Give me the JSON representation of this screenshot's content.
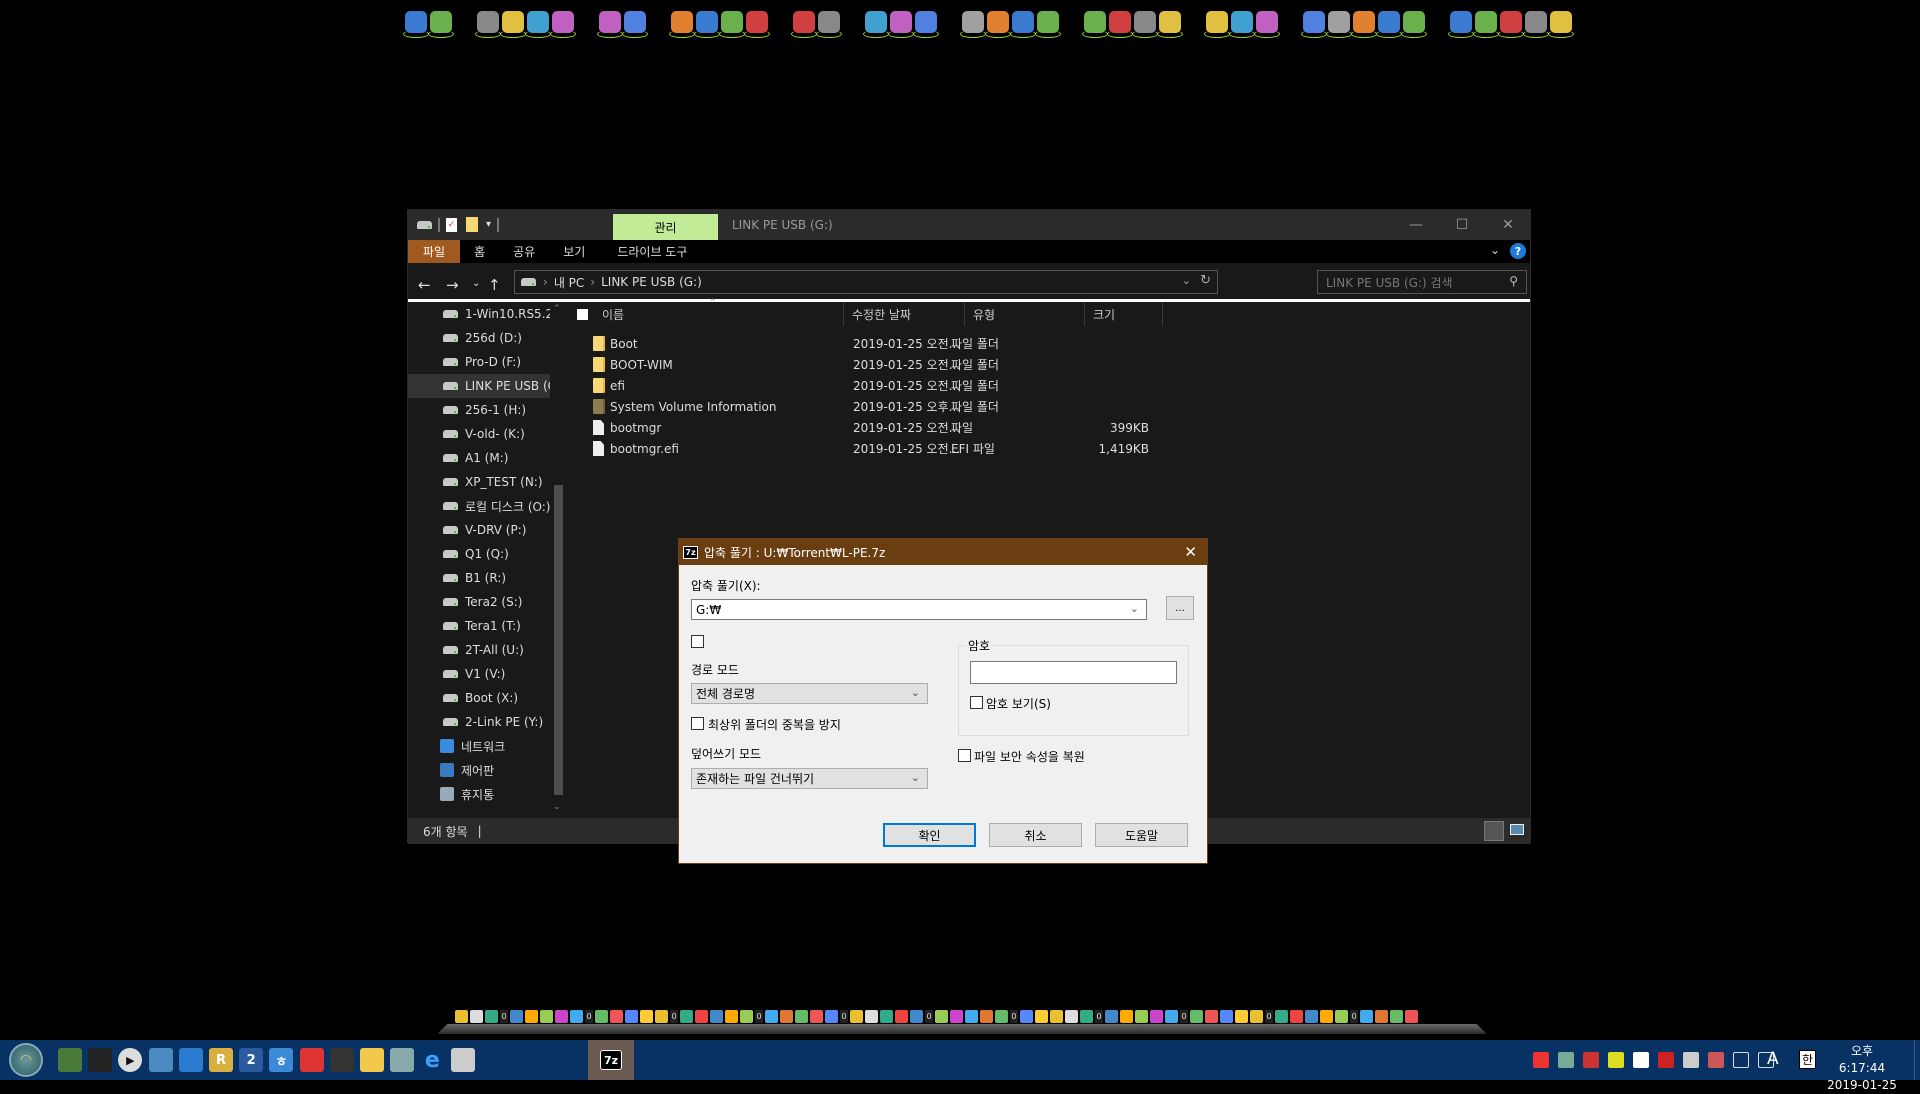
{
  "top_launcher": {
    "groups": [
      [
        "network-setup-icon",
        "network-disable-icon"
      ],
      [
        "laptop-icon",
        "monitor-icon",
        "tablet-icon",
        "red-tool-icon"
      ],
      [
        "puzzle-icon",
        "red-puzzle-icon"
      ],
      [
        "eraser-icon",
        "file-page-icon",
        "flower-icon",
        "windows-icon"
      ],
      [
        "pie-chart-icon",
        "paint-icon"
      ],
      [
        "pc-tower-icon",
        "text-a-icon",
        "fc-icon"
      ],
      [
        "nt-key-icon",
        "tools-icon",
        "recycle-icon",
        "cloud-icon"
      ],
      [
        "lightning-icon",
        "7zip-icon",
        "disc-icon",
        "usb-icon"
      ],
      [
        "cpu-64-icon",
        "chip-icon",
        "flash-icon"
      ],
      [
        "hdd-icon",
        "scanner-icon",
        "disk-wrench-icon",
        "blocks-icon",
        "unlock-icon"
      ],
      [
        "search-orange-icon",
        "search-blue-icon",
        "floppy-icon",
        "folder-dark-icon",
        "power-icon"
      ]
    ]
  },
  "explorer": {
    "qat_icons": [
      "drive-icon",
      "properties-icon",
      "new-folder-icon",
      "customize-qat-icon"
    ],
    "contextual_tab": "관리",
    "title": "LINK PE USB (G:)",
    "window_buttons": {
      "minimize": "—",
      "maximize": "☐",
      "close": "✕"
    },
    "ribbon_tabs": [
      "파일",
      "홈",
      "공유",
      "보기",
      "드라이브 도구"
    ],
    "address": {
      "breadcrumb": [
        "내 PC",
        "LINK PE USB (G:)"
      ],
      "search_placeholder": "LINK PE USB (G:) 검색"
    },
    "nav_pane": {
      "drives": [
        "1-Win10.RS5.2",
        "256d (D:)",
        "Pro-D (F:)",
        "LINK PE USB (G:)",
        "256-1 (H:)",
        "V-old- (K:)",
        "A1 (M:)",
        "XP_TEST (N:)",
        "로컬 디스크 (O:)",
        "V-DRV (P:)",
        "Q1 (Q:)",
        "B1 (R:)",
        "Tera2 (S:)",
        "Tera1 (T:)",
        "2T-All (U:)",
        "V1 (V:)",
        "Boot (X:)",
        "2-Link PE (Y:)"
      ],
      "selected_index": 3,
      "locations": [
        {
          "label": "네트워크",
          "icon": "network-icon"
        },
        {
          "label": "제어판",
          "icon": "control-panel-icon"
        },
        {
          "label": "휴지통",
          "icon": "recycle-bin-icon"
        }
      ]
    },
    "columns": [
      "이름",
      "수정한 날짜",
      "유형",
      "크기"
    ],
    "files": [
      {
        "name": "Boot",
        "date": "2019-01-25 오전...",
        "type": "파일 폴더",
        "size": "",
        "kind": "folder"
      },
      {
        "name": "BOOT-WIM",
        "date": "2019-01-25 오전...",
        "type": "파일 폴더",
        "size": "",
        "kind": "folder"
      },
      {
        "name": "efi",
        "date": "2019-01-25 오전...",
        "type": "파일 폴더",
        "size": "",
        "kind": "folder"
      },
      {
        "name": "System Volume Information",
        "date": "2019-01-25 오후...",
        "type": "파일 폴더",
        "size": "",
        "kind": "sysfolder"
      },
      {
        "name": "bootmgr",
        "date": "2019-01-25 오전...",
        "type": "파일",
        "size": "399KB",
        "kind": "file"
      },
      {
        "name": "bootmgr.efi",
        "date": "2019-01-25 오전...",
        "type": "EFI 파일",
        "size": "1,419KB",
        "kind": "file"
      }
    ],
    "status": "6개 항목",
    "view_buttons": [
      "details-view",
      "large-icons-view"
    ]
  },
  "extract_dialog": {
    "title": "압축 풀기 : U:₩Torrent₩L-PE.7z",
    "extract_to_label": "압축 풀기(X):",
    "extract_to_value": "G:₩",
    "browse_label": "...",
    "path_mode_label": "경로 모드",
    "path_mode_value": "전체 경로명",
    "eliminate_duplicate_label": "최상위 폴더의 중복을 방지",
    "overwrite_mode_label": "덮어쓰기 모드",
    "overwrite_mode_value": "존재하는 파일 건너뛰기",
    "password_group_label": "암호",
    "password_value": "",
    "show_password_label": "암호 보기(S)",
    "restore_security_label": "파일 보안 속성을 복원",
    "ok_label": "확인",
    "cancel_label": "취소",
    "help_label": "도움말",
    "close_label": "✕"
  },
  "dock": {
    "separator_label": "0"
  },
  "taskbar": {
    "start_icon": "shell-start-icon",
    "pinned": [
      {
        "name": "multi-app-icon",
        "glyph": "",
        "color": "#4a7a3a"
      },
      {
        "name": "color-monitor-icon",
        "glyph": "",
        "color": "#222"
      },
      {
        "name": "media-player-icon",
        "glyph": "▶",
        "color": "#ddd"
      },
      {
        "name": "chart-app-icon",
        "glyph": "",
        "color": "#4a8ac0"
      },
      {
        "name": "recovery-icon",
        "glyph": "",
        "color": "#2a7ad0"
      },
      {
        "name": "r-app-icon",
        "glyph": "R",
        "color": "#d9b040"
      },
      {
        "name": "number-2-icon",
        "glyph": "2",
        "color": "#2a5aa0"
      },
      {
        "name": "hangul-editor-icon",
        "glyph": "ㅎ",
        "color": "#3a8ad8"
      },
      {
        "name": "partition-icon",
        "glyph": "",
        "color": "#dd3333"
      },
      {
        "name": "dark-folder-icon",
        "glyph": "",
        "color": "#333"
      },
      {
        "name": "file-explorer-icon",
        "glyph": "",
        "color": "#f2c94c"
      },
      {
        "name": "resource-monitor-icon",
        "glyph": "",
        "color": "#8aa"
      },
      {
        "name": "internet-explorer-icon",
        "glyph": "e",
        "color": "#1e90ff"
      },
      {
        "name": "usb-drive-icon",
        "glyph": "",
        "color": "#ccc"
      },
      {
        "name": "7zip-taskbar-icon",
        "glyph": "7z",
        "color": "#000"
      }
    ],
    "tray_icons": [
      "network-speed-icon",
      "osd-icon",
      "security-icon",
      "ie-toy-icon",
      "font-icon",
      "magnet-icon",
      "network-icon",
      "usb-eject-icon",
      "usb-device-icon",
      "volume-icon"
    ],
    "ime_label": "A",
    "hangul_label": "한",
    "time": "오후 6:17:44",
    "date": "2019-01-25"
  }
}
